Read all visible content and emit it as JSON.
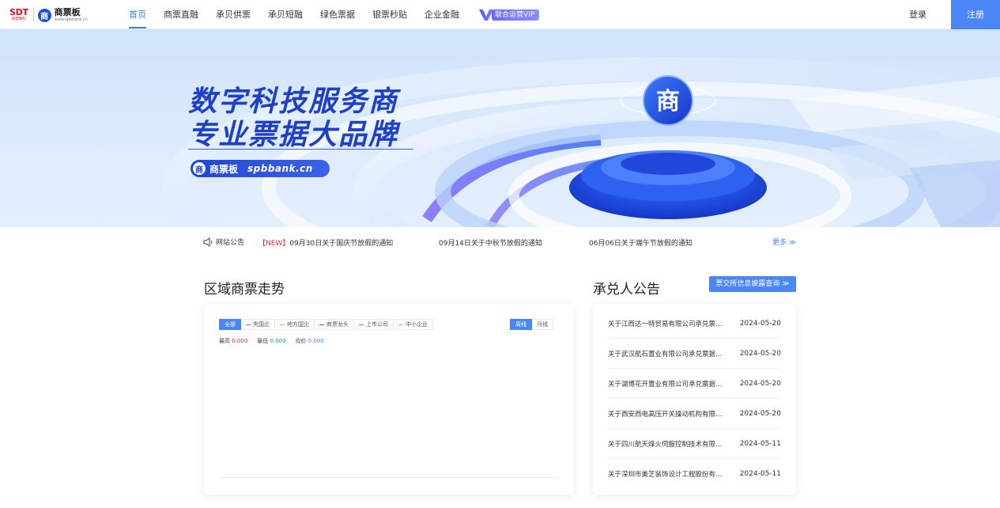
{
  "logo": {
    "sdt": "SDT",
    "sdt_sub": "联票数科",
    "mark": "商",
    "brand": "商票板",
    "url": "www.spbbank.cn"
  },
  "nav": {
    "items": [
      {
        "label": "首页",
        "active": true
      },
      {
        "label": "商票直融",
        "active": false
      },
      {
        "label": "承贝供票",
        "active": false
      },
      {
        "label": "承贝短融",
        "active": false
      },
      {
        "label": "绿色票据",
        "active": false
      },
      {
        "label": "银票秒贴",
        "active": false
      },
      {
        "label": "企业金融",
        "active": false
      }
    ],
    "vip_label": "联合运营VIP",
    "login": "登录",
    "register": "注册"
  },
  "banner": {
    "line1": "数字科技服务商",
    "line2": "专业票据大品牌",
    "badge_mark": "商",
    "badge_name": "商票板",
    "badge_url": "spbbank.cn",
    "emblem": "商"
  },
  "notice": {
    "label": "网站公告",
    "new_tag": "【NEW】",
    "item1": "09月30日关于国庆节放假的通知",
    "item2": "09月14日关于中秋节放假的通知",
    "item3": "06月06日关于端午节放假的通知",
    "more": "更多 ≫"
  },
  "trend": {
    "title": "区域商票走势",
    "filters": [
      {
        "label": "全部",
        "active": true,
        "color": ""
      },
      {
        "label": "央国企",
        "active": false,
        "color": "#e85a8f"
      },
      {
        "label": "地方国企",
        "active": false,
        "color": "#f0a84a"
      },
      {
        "label": "商票龙头",
        "active": false,
        "color": "#e02b2b"
      },
      {
        "label": "上市公司",
        "active": false,
        "color": "#2fb56a"
      },
      {
        "label": "中小企业",
        "active": false,
        "color": "#5ad1b0"
      }
    ],
    "periods": [
      {
        "label": "周线",
        "active": true
      },
      {
        "label": "月线",
        "active": false
      }
    ],
    "stats": {
      "high_label": "最高",
      "high_value": "0.000",
      "low_label": "最低",
      "low_value": "0.000",
      "avg_label": "均价",
      "avg_value": "0.000"
    }
  },
  "acceptor": {
    "title": "承兑人公告",
    "query_button": "票交所信息披露查询 ≫",
    "rows": [
      {
        "title": "关于江西达一特贸易有限公司承兑票据…",
        "date": "2024-05-20"
      },
      {
        "title": "关于武汉航石置业有限公司承兑票据…",
        "date": "2024-05-20"
      },
      {
        "title": "关于湖博花开置业有限公司承兑票据…",
        "date": "2024-05-20"
      },
      {
        "title": "关于西安西电高压开关操动机构有限…",
        "date": "2024-05-20"
      },
      {
        "title": "关于四川航天烽火伺服控制技术有限…",
        "date": "2024-05-11"
      },
      {
        "title": "关于深圳市美芝装饰设计工程股份有…",
        "date": "2024-05-11"
      }
    ]
  }
}
